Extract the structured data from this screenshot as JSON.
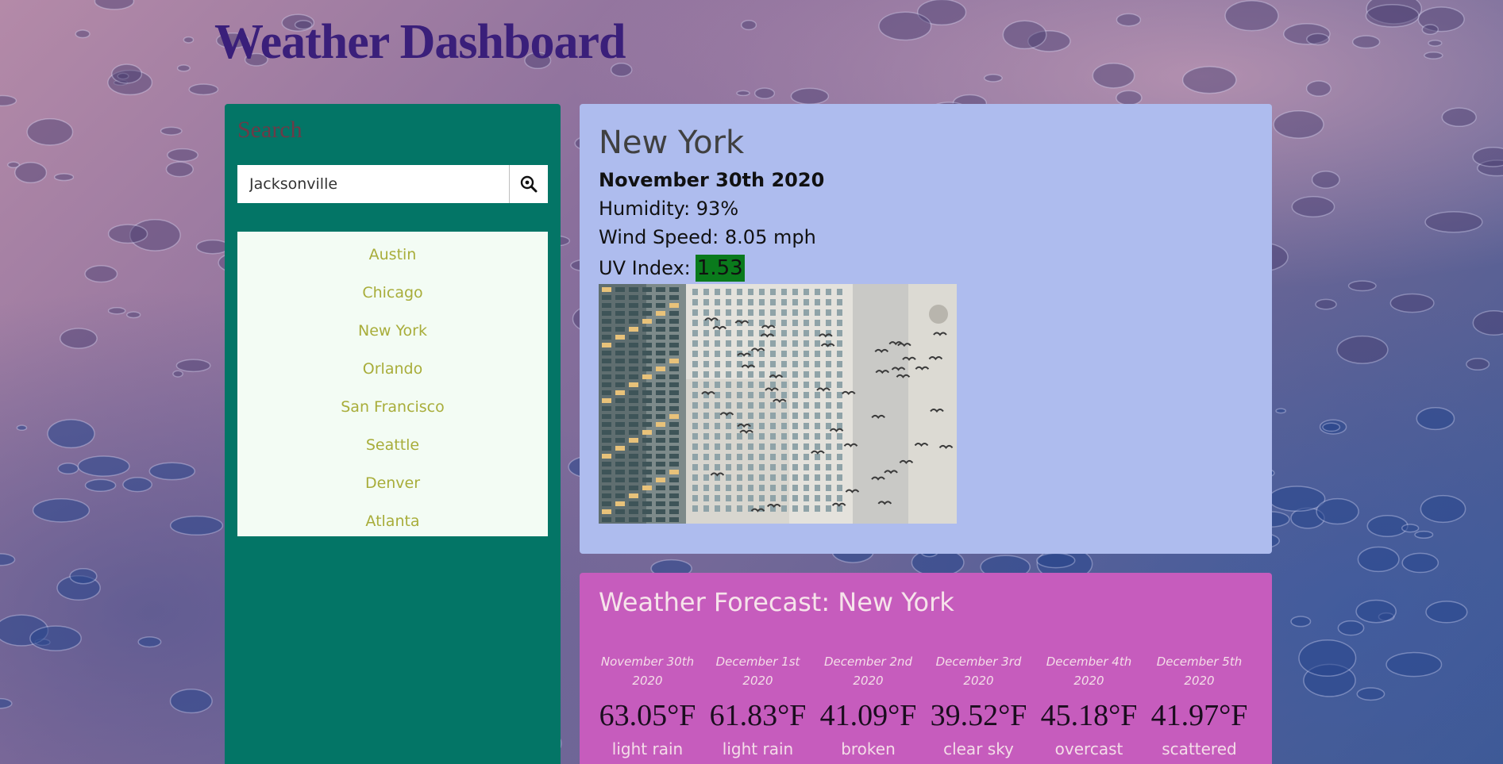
{
  "page": {
    "title": "Weather Dashboard"
  },
  "sidebar": {
    "title": "Search",
    "search": {
      "value": "Jacksonville",
      "placeholder": "",
      "button_icon": "search-magnify-icon"
    },
    "cities": [
      "Austin",
      "Chicago",
      "New York",
      "Orlando",
      "San Francisco",
      "Seattle",
      "Denver",
      "Atlanta"
    ]
  },
  "current": {
    "city": "New York",
    "date": "November 30th 2020",
    "humidity": "Humidity: 93%",
    "wind": "Wind Speed: 8.05 mph",
    "uv_label": "UV Index:",
    "uv_value": "1.53",
    "uv_color": "#0a7a1c"
  },
  "forecast": {
    "title": "Weather Forecast: New York",
    "days": [
      {
        "date": "November 30th 2020",
        "temp": "63.05°F",
        "desc": "light rain"
      },
      {
        "date": "December 1st 2020",
        "temp": "61.83°F",
        "desc": "light rain"
      },
      {
        "date": "December 2nd 2020",
        "temp": "41.09°F",
        "desc": "broken"
      },
      {
        "date": "December 3rd 2020",
        "temp": "39.52°F",
        "desc": "clear sky"
      },
      {
        "date": "December 4th 2020",
        "temp": "45.18°F",
        "desc": "overcast"
      },
      {
        "date": "December 5th 2020",
        "temp": "41.97°F",
        "desc": "scattered"
      }
    ]
  },
  "colors": {
    "title": "#3a1f7a",
    "sidebar": "#037566",
    "city_list_bg": "#f3fcf4",
    "city_text": "#a8ad3a",
    "current_card": "#aebcee",
    "forecast_card": "#c65cbd"
  }
}
